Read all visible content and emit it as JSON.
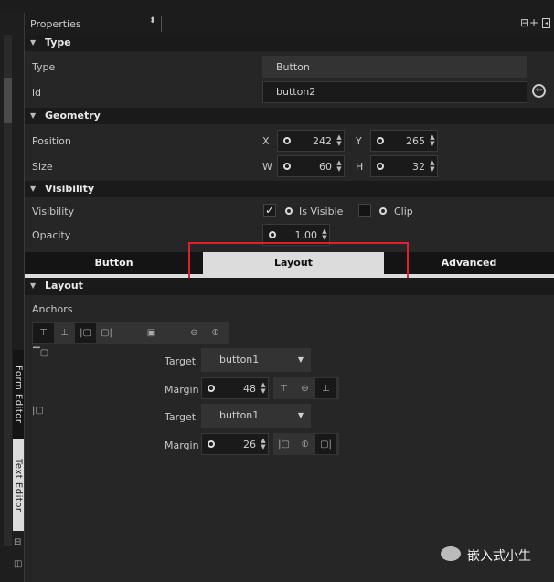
{
  "header": {
    "title": "Properties"
  },
  "sections": {
    "type": "Type",
    "geometry": "Geometry",
    "visibility": "Visibility",
    "layout": "Layout"
  },
  "type": {
    "type_label": "Type",
    "type_value": "Button",
    "id_label": "id",
    "id_value": "button2"
  },
  "geometry": {
    "position_label": "Position",
    "size_label": "Size",
    "x_label": "X",
    "x": "242",
    "y_label": "Y",
    "y": "265",
    "w_label": "W",
    "w": "60",
    "h_label": "H",
    "h": "32"
  },
  "visibility": {
    "label": "Visibility",
    "is_visible": "Is Visible",
    "is_visible_checked": true,
    "clip": "Clip",
    "clip_checked": false,
    "opacity_label": "Opacity",
    "opacity": "1.00"
  },
  "tabs": [
    {
      "label": "Button",
      "active": false
    },
    {
      "label": "Layout",
      "active": true
    },
    {
      "label": "Advanced",
      "active": false
    }
  ],
  "layout": {
    "anchors_label": "Anchors",
    "target_label": "Target",
    "margin_label": "Margin",
    "v_target": "button1",
    "v_margin": "48",
    "h_target": "button1",
    "h_margin": "26"
  },
  "side_tabs": {
    "form_editor": "Form Editor",
    "text_editor": "Text Editor"
  },
  "watermark": "嵌入式小生",
  "colors": {
    "highlight_box": "#e0202a",
    "active_tab": "#dcdcdc"
  }
}
